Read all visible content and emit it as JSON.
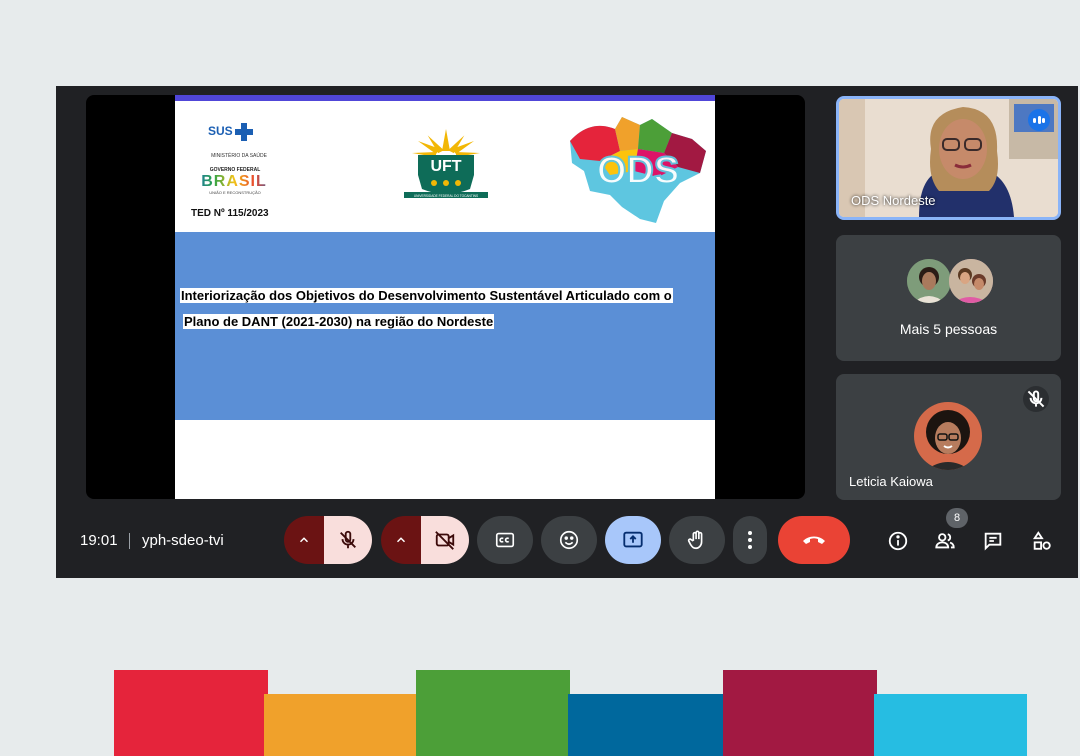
{
  "slide": {
    "sus_label": "SUS",
    "ministerio": "MINISTÉRIO DA SAÚDE",
    "governo": "GOVERNO FEDERAL",
    "brasil": "BRASIL",
    "uniao": "UNIÃO E RECONSTRUÇÃO",
    "ted": "TED Nº 115/2023",
    "uft": "UFT",
    "uft_caption": "UNIVERSIDADE FEDERAL DO TOCANTINS",
    "ods": "ODS",
    "title_line1": "Interiorização dos Objetivos do Desenvolvimento Sustentável Articulado com o",
    "title_line2": "Plano de DANT  (2021-2030) na região do Nordeste"
  },
  "participants": [
    {
      "name": "ODS Nordeste",
      "speaking": true
    },
    {
      "label": "Mais 5 pessoas"
    },
    {
      "name": "Leticia Kaiowa",
      "muted": true
    }
  ],
  "meeting": {
    "time": "19:01",
    "code": "yph-sdeo-tvi",
    "participant_count": "8"
  },
  "icons": {
    "mic": "mic-off-icon",
    "camera": "camera-off-icon",
    "captions": "captions-icon",
    "emoji": "emoji-icon",
    "present": "present-icon",
    "hand": "raise-hand-icon",
    "more": "more-vert-icon",
    "end": "end-call-icon",
    "info": "info-icon",
    "people": "people-icon",
    "chat": "chat-icon",
    "activities": "activities-icon"
  },
  "colors": {
    "accent": "#8ab4f8",
    "end_call": "#ea4335",
    "present_active": "#a8c7fa",
    "muted_button": "#f9dedc",
    "sdg_strip": [
      "#e5243b",
      "#f0a12b",
      "#4c9f38",
      "#00689d",
      "#a21942",
      "#26bde2"
    ]
  }
}
